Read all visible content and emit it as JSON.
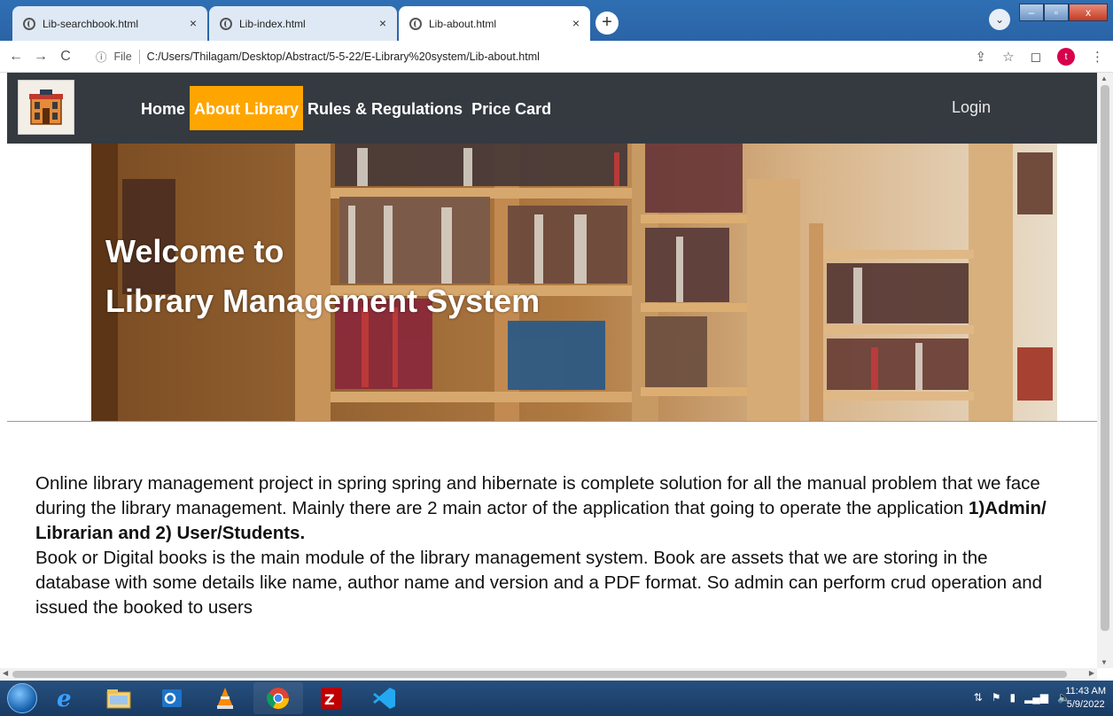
{
  "browser": {
    "tabs": [
      {
        "title": "Lib-searchbook.html",
        "active": false
      },
      {
        "title": "Lib-index.html",
        "active": false
      },
      {
        "title": "Lib-about.html",
        "active": true
      }
    ],
    "close_glyph": "×",
    "new_tab_glyph": "+",
    "profile_chevron": "⌄",
    "window_controls": {
      "minimize": "–",
      "maximize": "▫",
      "close": "x"
    },
    "address": {
      "info_icon": "ⓘ",
      "scheme_label": "File",
      "url": "C:/Users/Thilagam/Desktop/Abstract/5-5-22/E-Library%20system/Lib-about.html"
    },
    "nav": {
      "back": "←",
      "forward": "→",
      "reload": "C"
    },
    "profile_initial": "t",
    "right_icons": {
      "share": "⇪",
      "star": "☆",
      "sidepanel": "◻",
      "menu": "⋮"
    }
  },
  "site": {
    "nav_items": [
      {
        "label": "Home",
        "active": false
      },
      {
        "label": "About Library",
        "active": true
      },
      {
        "label": "Rules & Regulations",
        "active": false
      },
      {
        "label": "Price Card",
        "active": false
      }
    ],
    "login_label": "Login",
    "banner": {
      "line1": "Welcome to",
      "line2": "Library Management System"
    },
    "about": {
      "p1_start": "Online library management project in spring spring and hibernate is complete solution for all the manual problem that we face during the library management. Mainly there are 2 main actor of the application that going to operate the application ",
      "p1_bold": "1)Admin/ Librarian and 2) User/Students.",
      "p2": "Book or Digital books is the main module of the library management system. Book are assets that we are storing in the database with some details like name, author name and version and a PDF format. So admin can perform crud operation and issued the booked to users"
    }
  },
  "taskbar": {
    "clock_time": "11:43 AM",
    "clock_date": "5/9/2022"
  },
  "colors": {
    "navbar_bg": "#343a40",
    "nav_active_bg": "#ffa500",
    "tab_strip": "#2f6fb3"
  }
}
